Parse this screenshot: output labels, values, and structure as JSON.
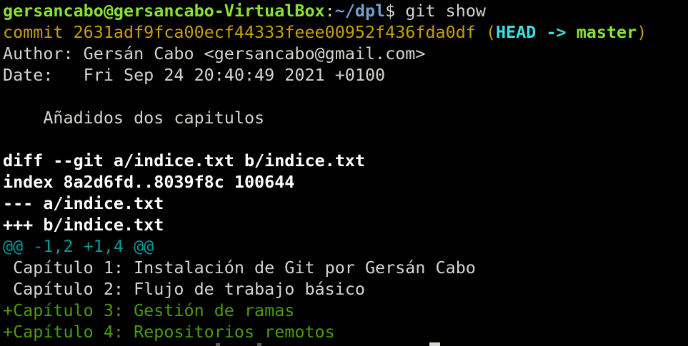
{
  "prompt": {
    "user_host": "gersancabo@gersancabo-VirtualBox",
    "sep": ":",
    "path": "~/dpl",
    "symbol": "$ ",
    "command": "git show"
  },
  "commit": {
    "label_and_hash": "commit 2631adf9fca00ecf44333feee00952f436fda0df",
    "paren_open": " (",
    "head": "HEAD -> ",
    "branch": "master",
    "paren_close": ")"
  },
  "author_line": "Author: Gersán Cabo <gersancabo@gmail.com>",
  "date_line": "Date:   Fri Sep 24 20:40:49 2021 +0100",
  "message_line": "    Añadidos dos capitulos",
  "diff": {
    "git_line": "diff --git a/indice.txt b/indice.txt",
    "index_line": "index 8a2d6fd..8039f8c 100644",
    "minus_line": "--- a/indice.txt",
    "plus_line": "+++ b/indice.txt",
    "hunk_line": "@@ -1,2 +1,4 @@",
    "context_lines": [
      " Capítulo 1: Instalación de Git por Gersán Cabo",
      " Capítulo 2: Flujo de trabajo básico"
    ],
    "added_lines": [
      "+Capítulo 3: Gestión de ramas",
      "+Capítulo 4: Repositorios remotos"
    ]
  },
  "colors": {
    "background": "#000000",
    "foreground": "#d3d7cf",
    "prompt_user": "#8ae234",
    "prompt_path": "#729fcf",
    "commit": "#c4a000",
    "head": "#34e2e2",
    "hunk": "#06989a",
    "added": "#4e9a06"
  }
}
